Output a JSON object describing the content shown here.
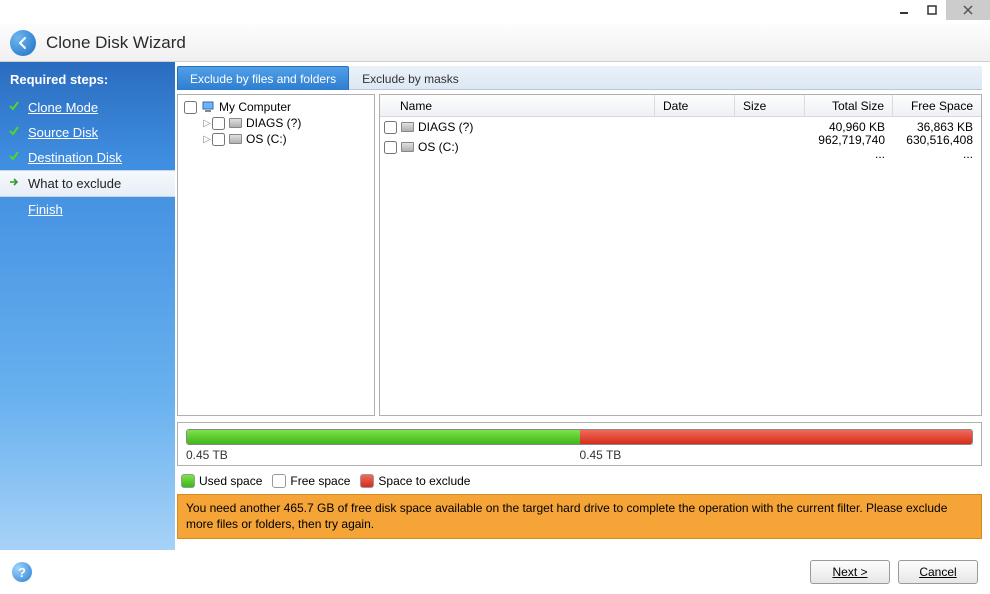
{
  "window": {
    "title": "Clone Disk Wizard"
  },
  "sidebar": {
    "heading": "Required steps:",
    "steps": [
      {
        "label": "Clone Mode",
        "state": "done"
      },
      {
        "label": "Source Disk",
        "state": "done"
      },
      {
        "label": "Destination Disk",
        "state": "done"
      },
      {
        "label": "What to exclude",
        "state": "current"
      },
      {
        "label": "Finish",
        "state": "future"
      }
    ]
  },
  "tabs": {
    "active": "Exclude by files and folders",
    "inactive": "Exclude by masks"
  },
  "tree": {
    "root": "My Computer",
    "children": [
      {
        "label": "DIAGS (?)"
      },
      {
        "label": "OS (C:)"
      }
    ]
  },
  "list": {
    "columns": {
      "name": "Name",
      "date": "Date",
      "size": "Size",
      "total": "Total Size",
      "free": "Free Space"
    },
    "rows": [
      {
        "name": "DIAGS (?)",
        "date": "",
        "size": "",
        "total": "40,960 KB",
        "free": "36,863 KB"
      },
      {
        "name": "OS (C:)",
        "date": "",
        "size": "",
        "total": "962,719,740 ...",
        "free": "630,516,408 ..."
      }
    ]
  },
  "bar": {
    "used_label": "0.45 TB",
    "exclude_label": "0.45 TB",
    "used_pct": 50,
    "exclude_pct": 50
  },
  "legend": {
    "used": "Used space",
    "free": "Free space",
    "exclude": "Space to exclude"
  },
  "warning": "You need another 465.7 GB of free disk space available on the target hard drive to complete the operation with the current filter. Please exclude more files or folders, then try again.",
  "footer": {
    "next": "Next >",
    "cancel": "Cancel"
  }
}
